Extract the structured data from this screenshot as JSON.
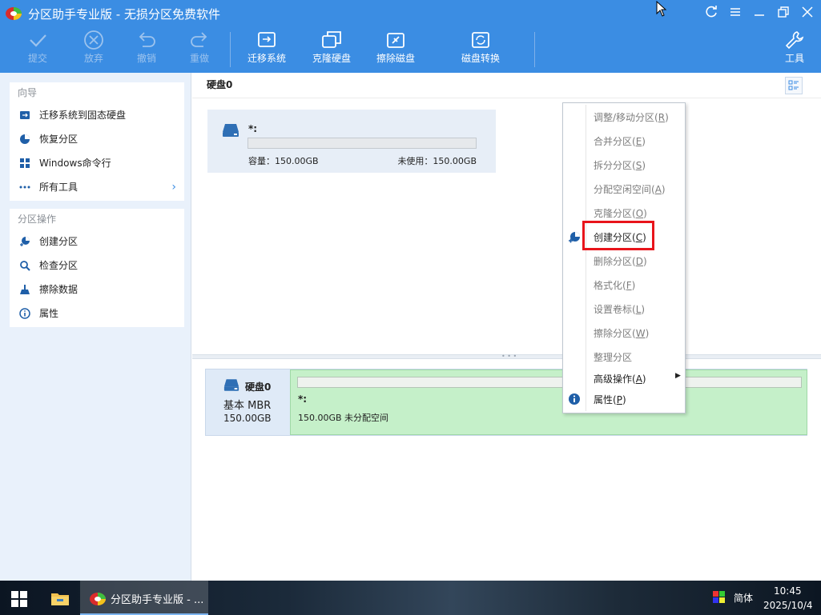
{
  "window": {
    "title": "分区助手专业版 - 无损分区免费软件",
    "controls": {
      "refresh": "refresh-icon",
      "menu": "menu-icon",
      "minimize": "minimize-icon",
      "restore": "restore-icon",
      "close": "close-icon"
    }
  },
  "toolbar": {
    "commit": "提交",
    "discard": "放弃",
    "undo": "撤销",
    "redo": "重做",
    "migrate_os": "迁移系统",
    "clone_disk": "克隆硬盘",
    "wipe_disk": "擦除磁盘",
    "disk_convert": "磁盘转换",
    "tools": "工具"
  },
  "sidebar": {
    "wizard": {
      "title": "向导",
      "items": [
        {
          "label": "迁移系统到固态硬盘",
          "icon": "ssd-migrate-icon"
        },
        {
          "label": "恢复分区",
          "icon": "restore-partition-icon"
        },
        {
          "label": "Windows命令行",
          "icon": "windows-icon"
        },
        {
          "label": "所有工具",
          "icon": "more-dots-icon"
        }
      ]
    },
    "partition_ops": {
      "title": "分区操作",
      "items": [
        {
          "label": "创建分区",
          "icon": "create-partition-icon"
        },
        {
          "label": "检查分区",
          "icon": "check-partition-icon"
        },
        {
          "label": "擦除数据",
          "icon": "wipe-data-icon"
        },
        {
          "label": "属性",
          "icon": "info-icon"
        }
      ]
    }
  },
  "main": {
    "disk_header": "硬盘0",
    "partition_card": {
      "name": "*:",
      "capacity": "容量：150.00GB",
      "unused": "未使用：150.00GB"
    },
    "disk_map": {
      "disk_name": "硬盘0",
      "disk_type": "基本 MBR",
      "disk_size": "150.00GB",
      "partition_name": "*:",
      "partition_desc": "150.00GB 未分配空间"
    }
  },
  "context_menu": {
    "items": [
      {
        "pre": "调整/移动分区(",
        "key": "R",
        "post": ")",
        "enabled": false
      },
      {
        "pre": "合并分区(",
        "key": "E",
        "post": ")",
        "enabled": false
      },
      {
        "pre": "拆分分区(",
        "key": "S",
        "post": ")",
        "enabled": false
      },
      {
        "pre": "分配空闲空间(",
        "key": "A",
        "post": ")",
        "enabled": false
      },
      {
        "pre": "克隆分区(",
        "key": "O",
        "post": ")",
        "enabled": false
      },
      {
        "pre": "创建分区(",
        "key": "C",
        "post": ")",
        "enabled": true
      },
      {
        "pre": "删除分区(",
        "key": "D",
        "post": ")",
        "enabled": false
      },
      {
        "pre": "格式化(",
        "key": "F",
        "post": ")",
        "enabled": false
      },
      {
        "pre": "设置卷标(",
        "key": "L",
        "post": ")",
        "enabled": false
      },
      {
        "pre": "擦除分区(",
        "key": "W",
        "post": ")",
        "enabled": false
      },
      {
        "pre": "整理分区",
        "key": "",
        "post": "",
        "enabled": false
      },
      {
        "pre": "高级操作(",
        "key": "A",
        "post": ")",
        "enabled": true
      },
      {
        "pre": "属性(",
        "key": "P",
        "post": ")",
        "enabled": true
      }
    ]
  },
  "taskbar": {
    "app_label": "分区助手专业版 - ...",
    "ime": "简体",
    "time": "10:45",
    "date": "2025/10/4"
  },
  "colors": {
    "accent": "#3b8de3",
    "highlight": "#e8141b",
    "unallocated": "#c5f0c9"
  }
}
